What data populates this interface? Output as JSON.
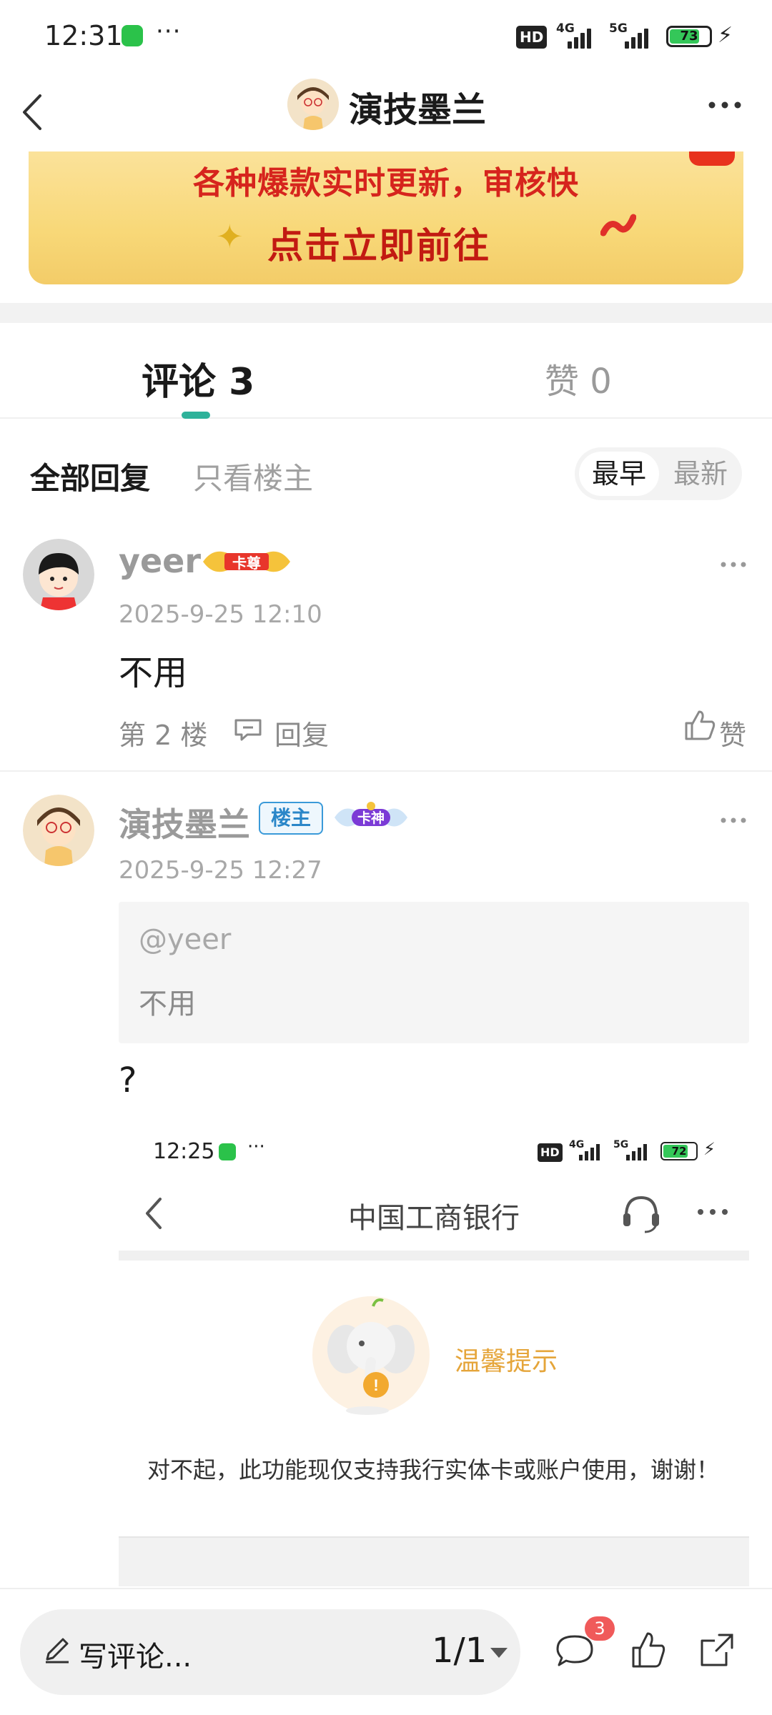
{
  "status_bar": {
    "time": "12:31",
    "dots": "···",
    "hd": "HD",
    "net1": "4G",
    "net2": "5G",
    "battery": "73"
  },
  "header": {
    "title": "演技墨兰",
    "back_icon": "chevron-left-icon",
    "more_icon": "more-horizontal-icon"
  },
  "banner": {
    "line1": "各种爆款实时更新，审核快",
    "line2": "点击立即前往"
  },
  "tabs": [
    {
      "label": "评论 3",
      "active": true
    },
    {
      "label": "赞 0",
      "active": false
    }
  ],
  "filters": {
    "all": "全部回复",
    "owner_only": "只看楼主",
    "sort_earliest": "最早",
    "sort_latest": "最新"
  },
  "comments": [
    {
      "user": "yeer",
      "badge": "卡尊",
      "time": "2025-9-25 12:10",
      "text": "不用",
      "floor": "第 2 楼",
      "reply_label": "回复",
      "like_label": "赞"
    },
    {
      "user": "演技墨兰",
      "owner_tag": "楼主",
      "badge": "卡神",
      "time": "2025-9-25 12:27",
      "quote_user": "@yeer",
      "quote_text": "不用",
      "text": "?"
    }
  ],
  "embedded_image": {
    "time": "12:25",
    "dots": "···",
    "hd": "HD",
    "net1": "4G",
    "net2": "5G",
    "battery": "72",
    "title": "中国工商银行",
    "tip_title": "温馨提示",
    "message": "对不起，此功能现仅支持我行实体卡或账户使用，谢谢！"
  },
  "bottom_bar": {
    "placeholder": "写评论...",
    "page": "1/1",
    "comment_count": "3"
  },
  "colors": {
    "accent": "#2eb29a",
    "badge_red": "#f05a5a",
    "owner_tag": "#2a86c8",
    "banner_text": "#d6241d",
    "tip_orange": "#e5a53a"
  }
}
